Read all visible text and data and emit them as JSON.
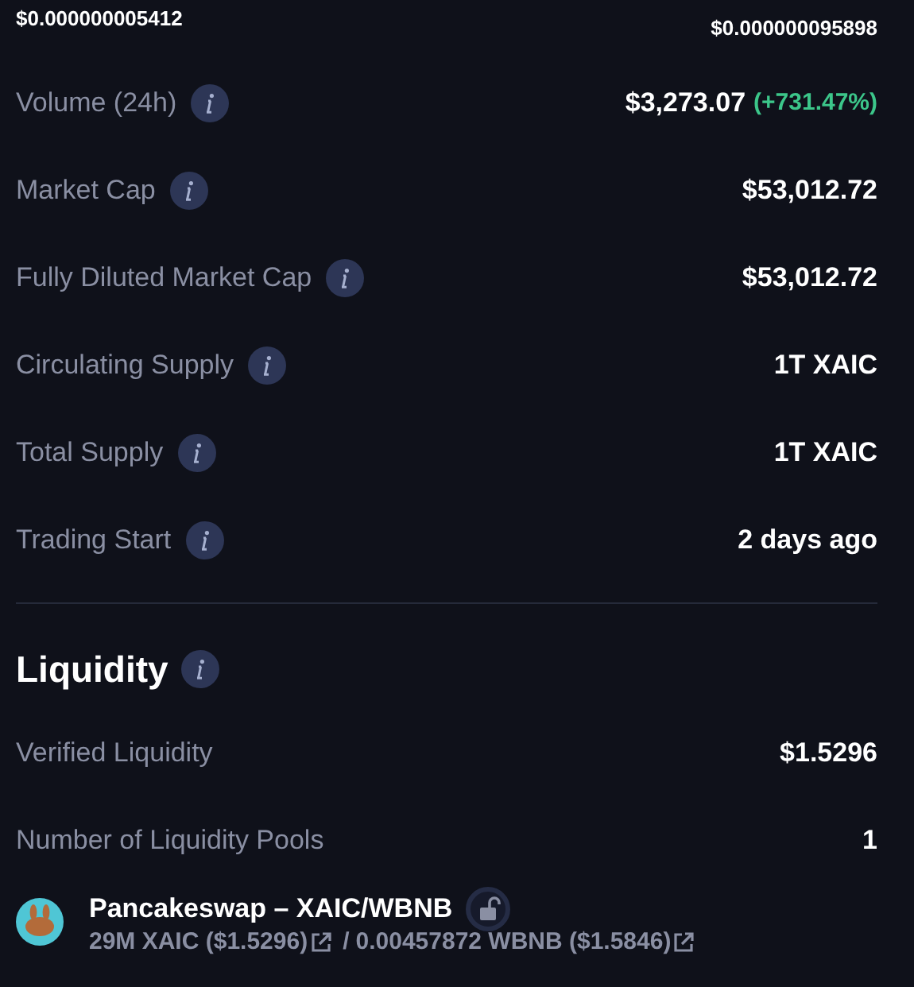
{
  "price_range": {
    "low": "$0.000000005412",
    "high": "$0.000000095898"
  },
  "stats": [
    {
      "label": "Volume (24h)",
      "info": true,
      "value": "$3,273.07",
      "change": "(+731.47%)"
    },
    {
      "label": "Market Cap",
      "info": true,
      "value": "$53,012.72"
    },
    {
      "label": "Fully Diluted Market Cap",
      "info": true,
      "value": "$53,012.72"
    },
    {
      "label": "Circulating Supply",
      "info": true,
      "value": "1T XAIC"
    },
    {
      "label": "Total Supply",
      "info": true,
      "value": "1T XAIC"
    },
    {
      "label": "Trading Start",
      "info": true,
      "value": "2 days ago"
    }
  ],
  "liquidity": {
    "title": "Liquidity",
    "info": true,
    "stats": [
      {
        "label": "Verified Liquidity",
        "info": false,
        "value": "$1.5296"
      },
      {
        "label": "Number of Liquidity Pools",
        "info": false,
        "value": "1"
      }
    ],
    "pools": [
      {
        "name": "Pancakeswap – XAIC/WBNB",
        "locked": false,
        "amounts": [
          "29M XAIC ($1.5296)",
          "0.00457872 WBNB ($1.5846)"
        ],
        "separator": "/"
      }
    ]
  }
}
